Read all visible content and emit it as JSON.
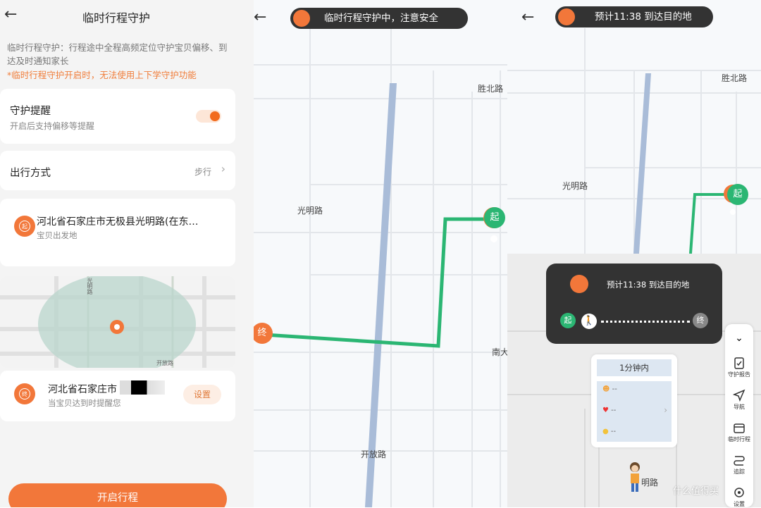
{
  "panel1": {
    "title": "临时行程守护",
    "description": "临时行程守护：行程途中全程高频定位守护宝贝偏移、到达及时通知家长",
    "warning": "*临时行程守护开启时，无法使用上下学守护功能",
    "reminder": {
      "title": "守护提醒",
      "subtitle": "开启后支持偏移等提醒",
      "enabled": true
    },
    "travel_mode": {
      "label": "出行方式",
      "value": "步行"
    },
    "start": {
      "badge": "起",
      "address": "河北省石家庄市无极县光明路(在东…",
      "subtitle": "宝贝出发地"
    },
    "mini_map_labels": [
      "光明路",
      "开放路"
    ],
    "end": {
      "badge": "终",
      "address": "河北省石家庄市",
      "subtitle": "当宝贝达到时提醒您",
      "button": "设置"
    },
    "start_button": "开启行程"
  },
  "panel2": {
    "banner": "临时行程守护中，注意安全",
    "roads": [
      "胜北路",
      "光明路",
      "开放路",
      "南大"
    ],
    "start_badge": "起",
    "end_badge": "终"
  },
  "panel3": {
    "banner": "预计11:38 到达目的地",
    "roads": [
      "胜北路",
      "光明路",
      "光明路",
      "明路"
    ],
    "start_badge": "起",
    "info_text": "预计11:38 到达目的地",
    "info_start": "起",
    "info_end": "终",
    "popup_title": "1分钟内",
    "stats": [
      "--",
      "--",
      "--"
    ],
    "sidebar": [
      "守护报告",
      "导航",
      "临时行程",
      "追踪",
      "设置"
    ]
  },
  "watermark": "什么值得买",
  "colors": {
    "accent": "#f2773a",
    "route": "#2bb673",
    "road": "#a9bcd8",
    "dark": "#333333"
  }
}
